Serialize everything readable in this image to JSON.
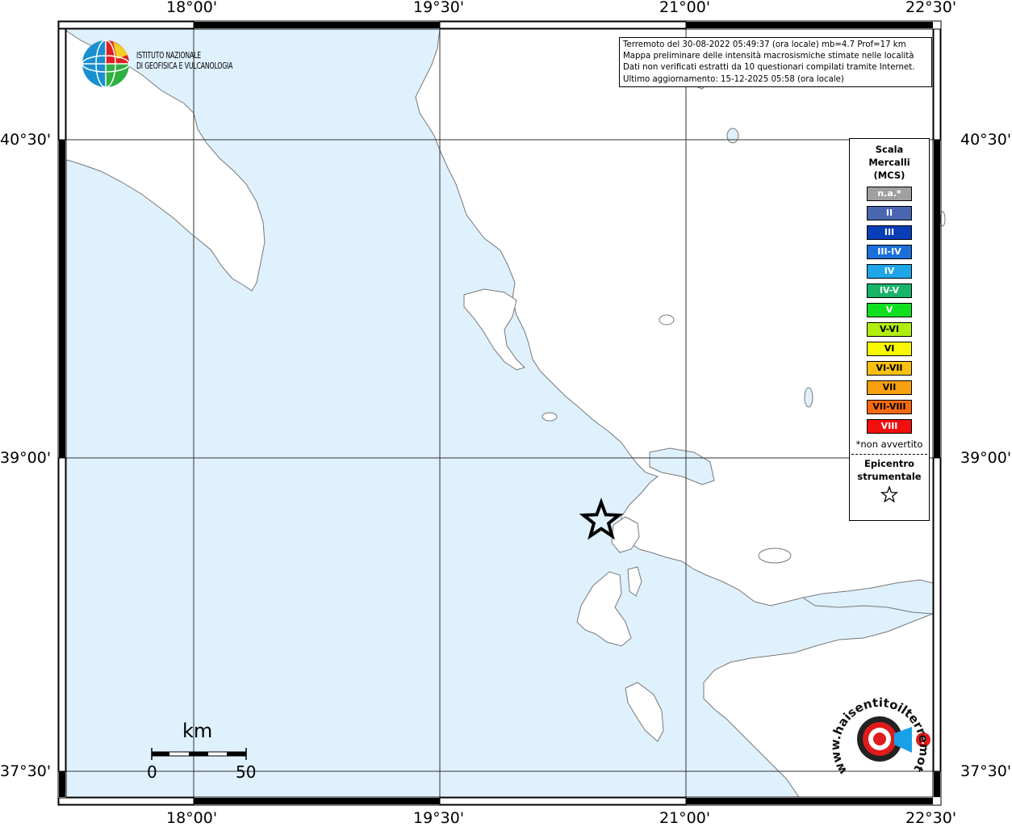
{
  "header": {
    "lines": [
      "Terremoto del 30-08-2022 05:49:37 (ora locale) mb=4.7 Prof=17 km",
      "Mappa preliminare delle intensità macrosismiche stimate nelle località",
      "Dati non verificati estratti da 10 questionari compilati tramite Internet.",
      "Ultimo aggiornamento: 15-12-2025 05:58 (ora locale)"
    ]
  },
  "logo": {
    "org_line1": "ISTITUTO NAZIONALE",
    "org_line2": "DI GEOFISICA E VULCANOLOGIA",
    "badge_text": "www.haisentitoilterremoto.it"
  },
  "axes": {
    "top_ticks": [
      "18°00'",
      "19°30'",
      "21°00'",
      "22°30'"
    ],
    "bottom_ticks": [
      "18°00'",
      "19°30'",
      "21°00'",
      "22°30'"
    ],
    "left_ticks": [
      "40°30'",
      "39°00'",
      "37°30'"
    ],
    "right_ticks": [
      "40°30'",
      "39°00'",
      "37°30'"
    ]
  },
  "legend": {
    "title_lines": [
      "Scala",
      "Mercalli",
      "(MCS)"
    ],
    "classes": [
      {
        "label": "n.a.*",
        "color": "#a0a0a0"
      },
      {
        "label": "II",
        "color": "#4a66b0"
      },
      {
        "label": "III",
        "color": "#0a3db8"
      },
      {
        "label": "III-IV",
        "color": "#1a70d8"
      },
      {
        "label": "IV",
        "color": "#1fa6e8"
      },
      {
        "label": "IV-V",
        "color": "#17b46a"
      },
      {
        "label": "V",
        "color": "#10e020"
      },
      {
        "label": "V-VI",
        "color": "#b0ee10"
      },
      {
        "label": "VI",
        "color": "#f8f800"
      },
      {
        "label": "VI-VII",
        "color": "#f8c010"
      },
      {
        "label": "VII",
        "color": "#f8a010"
      },
      {
        "label": "VII-VIII",
        "color": "#f86a10"
      },
      {
        "label": "VIII",
        "color": "#f00e0e"
      }
    ],
    "note": "*non avvertito",
    "epicenter_lines": [
      "Epicentro",
      "strumentale"
    ],
    "epicenter_symbol": "☆"
  },
  "scale_bar": {
    "unit": "km",
    "min_label": "0",
    "max_label": "50"
  },
  "colors": {
    "sea": "#dff1fd",
    "land": "#ffffff",
    "coast": "#7a7a7a"
  }
}
